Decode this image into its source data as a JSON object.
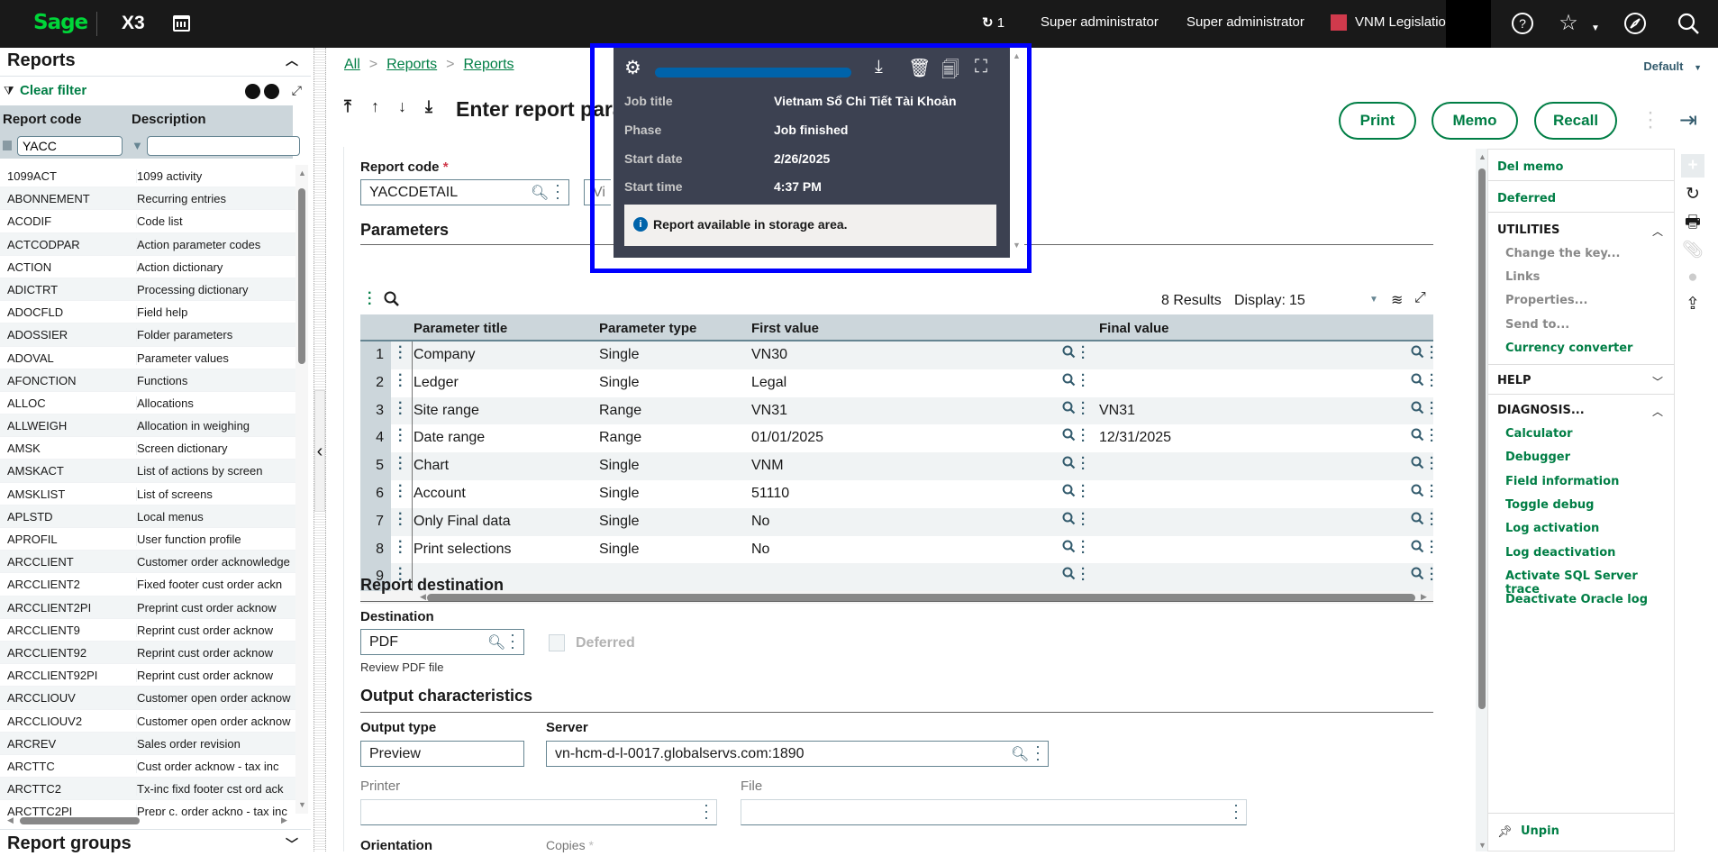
{
  "topbar": {
    "brand": "Sage",
    "product": "X3",
    "sync_count": "1",
    "user_1": "Super administrator",
    "user_2": "Super administrator",
    "legislation": "VNM Legislation",
    "legislation_color": "#d03a4c",
    "icons": [
      "calendar-icon",
      "sync-icon",
      "help-icon",
      "star-icon",
      "compass-icon",
      "search-icon"
    ]
  },
  "left": {
    "title": "Reports",
    "clear_filter": "Clear filter",
    "col_code": "Report code",
    "col_desc": "Description",
    "filter_code": "YACC",
    "filter_desc": "",
    "rows": [
      {
        "code": "1099ACT",
        "desc": "1099 activity"
      },
      {
        "code": "ABONNEMENT",
        "desc": "Recurring entries"
      },
      {
        "code": "ACODIF",
        "desc": "Code list"
      },
      {
        "code": "ACTCODPAR",
        "desc": "Action parameter codes"
      },
      {
        "code": "ACTION",
        "desc": "Action dictionary"
      },
      {
        "code": "ADICTRT",
        "desc": "Processing dictionary"
      },
      {
        "code": "ADOCFLD",
        "desc": "Field help"
      },
      {
        "code": "ADOSSIER",
        "desc": "Folder parameters"
      },
      {
        "code": "ADOVAL",
        "desc": "Parameter values"
      },
      {
        "code": "AFONCTION",
        "desc": "Functions"
      },
      {
        "code": "ALLOC",
        "desc": "Allocations"
      },
      {
        "code": "ALLWEIGH",
        "desc": "Allocation in weighing"
      },
      {
        "code": "AMSK",
        "desc": "Screen dictionary"
      },
      {
        "code": "AMSKACT",
        "desc": "List of actions by screen"
      },
      {
        "code": "AMSKLIST",
        "desc": "List of screens"
      },
      {
        "code": "APLSTD",
        "desc": "Local menus"
      },
      {
        "code": "APROFIL",
        "desc": "User function profile"
      },
      {
        "code": "ARCCLIENT",
        "desc": "Customer order acknowledge"
      },
      {
        "code": "ARCCLIENT2",
        "desc": "Fixed footer cust order ackn"
      },
      {
        "code": "ARCCLIENT2PI",
        "desc": "Preprint cust order acknow"
      },
      {
        "code": "ARCCLIENT9",
        "desc": "Reprint cust order acknow"
      },
      {
        "code": "ARCCLIENT92",
        "desc": "Reprint cust order acknow"
      },
      {
        "code": "ARCCLIENT92PI",
        "desc": "Reprint cust order acknow"
      },
      {
        "code": "ARCCLIOUV",
        "desc": "Customer open order acknow"
      },
      {
        "code": "ARCCLIOUV2",
        "desc": "Customer open order acknow"
      },
      {
        "code": "ARCREV",
        "desc": "Sales order revision"
      },
      {
        "code": "ARCTTC",
        "desc": "Cust order acknow - tax inc"
      },
      {
        "code": "ARCTTC2",
        "desc": "Tx-inc fixd footer cst ord ack"
      },
      {
        "code": "ARCTTC2PI",
        "desc": "Prepr c. order ackno - tax inc"
      }
    ],
    "report_groups": "Report groups"
  },
  "main": {
    "breadcrumb": [
      "All",
      "Reports",
      "Reports"
    ],
    "title": "Enter report parameters",
    "default_view": "Default",
    "buttons": {
      "print": "Print",
      "memo": "Memo",
      "recall": "Recall"
    },
    "report_code_label": "Report code",
    "report_code_value": "YACCDETAIL",
    "view_label": "Vi",
    "parameters_title": "Parameters",
    "results_text": "8 Results",
    "display_label": "Display:",
    "display_value": "15",
    "table": {
      "headers": [
        "Parameter title",
        "Parameter type",
        "First value",
        "Final value"
      ],
      "rows": [
        {
          "n": "1",
          "title": "Company",
          "type": "Single",
          "first": "VN30",
          "final": ""
        },
        {
          "n": "2",
          "title": "Ledger",
          "type": "Single",
          "first": "Legal",
          "final": ""
        },
        {
          "n": "3",
          "title": "Site range",
          "type": "Range",
          "first": "VN31",
          "final": "VN31"
        },
        {
          "n": "4",
          "title": "Date range",
          "type": "Range",
          "first": "01/01/2025",
          "final": "12/31/2025"
        },
        {
          "n": "5",
          "title": "Chart",
          "type": "Single",
          "first": "VNM",
          "final": ""
        },
        {
          "n": "6",
          "title": "Account",
          "type": "Single",
          "first": "51110",
          "final": ""
        },
        {
          "n": "7",
          "title": "Only Final data",
          "type": "Single",
          "first": "No",
          "final": ""
        },
        {
          "n": "8",
          "title": "Print selections",
          "type": "Single",
          "first": "No",
          "final": ""
        },
        {
          "n": "9",
          "title": "",
          "type": "",
          "first": "",
          "final": ""
        }
      ]
    },
    "report_destination_title": "Report destination",
    "destination_label": "Destination",
    "destination_value": "PDF",
    "deferred_label": "Deferred",
    "deferred_checked": false,
    "destination_hint": "Review PDF file",
    "output_title": "Output characteristics",
    "output_type_label": "Output type",
    "output_type_value": "Preview",
    "server_label": "Server",
    "server_value": "vn-hcm-d-l-0017.globalservs.com:1890",
    "printer_label": "Printer",
    "printer_value": "",
    "file_label": "File",
    "file_value": "",
    "orientation_label": "Orientation",
    "copies_label": "Copies"
  },
  "actions": {
    "del_memo": "Del memo",
    "deferred": "Deferred",
    "utilities": "UTILITIES",
    "utilities_items": [
      "Change the key...",
      "Links",
      "Properties...",
      "Send to..."
    ],
    "currency_converter": "Currency converter",
    "help": "HELP",
    "diagnosis": "DIAGNOSIS...",
    "diagnosis_items": [
      "Calculator",
      "Debugger",
      "Field information",
      "Toggle debug",
      "Log activation",
      "Log deactivation",
      "Activate SQL Server trace",
      "Deactivate Oracle log"
    ],
    "unpin": "Unpin"
  },
  "popup": {
    "progress": 1.0,
    "job_title_label": "Job title",
    "job_title_value": "Vietnam Sổ Chi Tiết Tài Khoản",
    "phase_label": "Phase",
    "phase_value": "Job finished",
    "start_date_label": "Start date",
    "start_date_value": "2/26/2025",
    "start_time_label": "Start time",
    "start_time_value": "4:37 PM",
    "message": "Report available in storage area."
  }
}
